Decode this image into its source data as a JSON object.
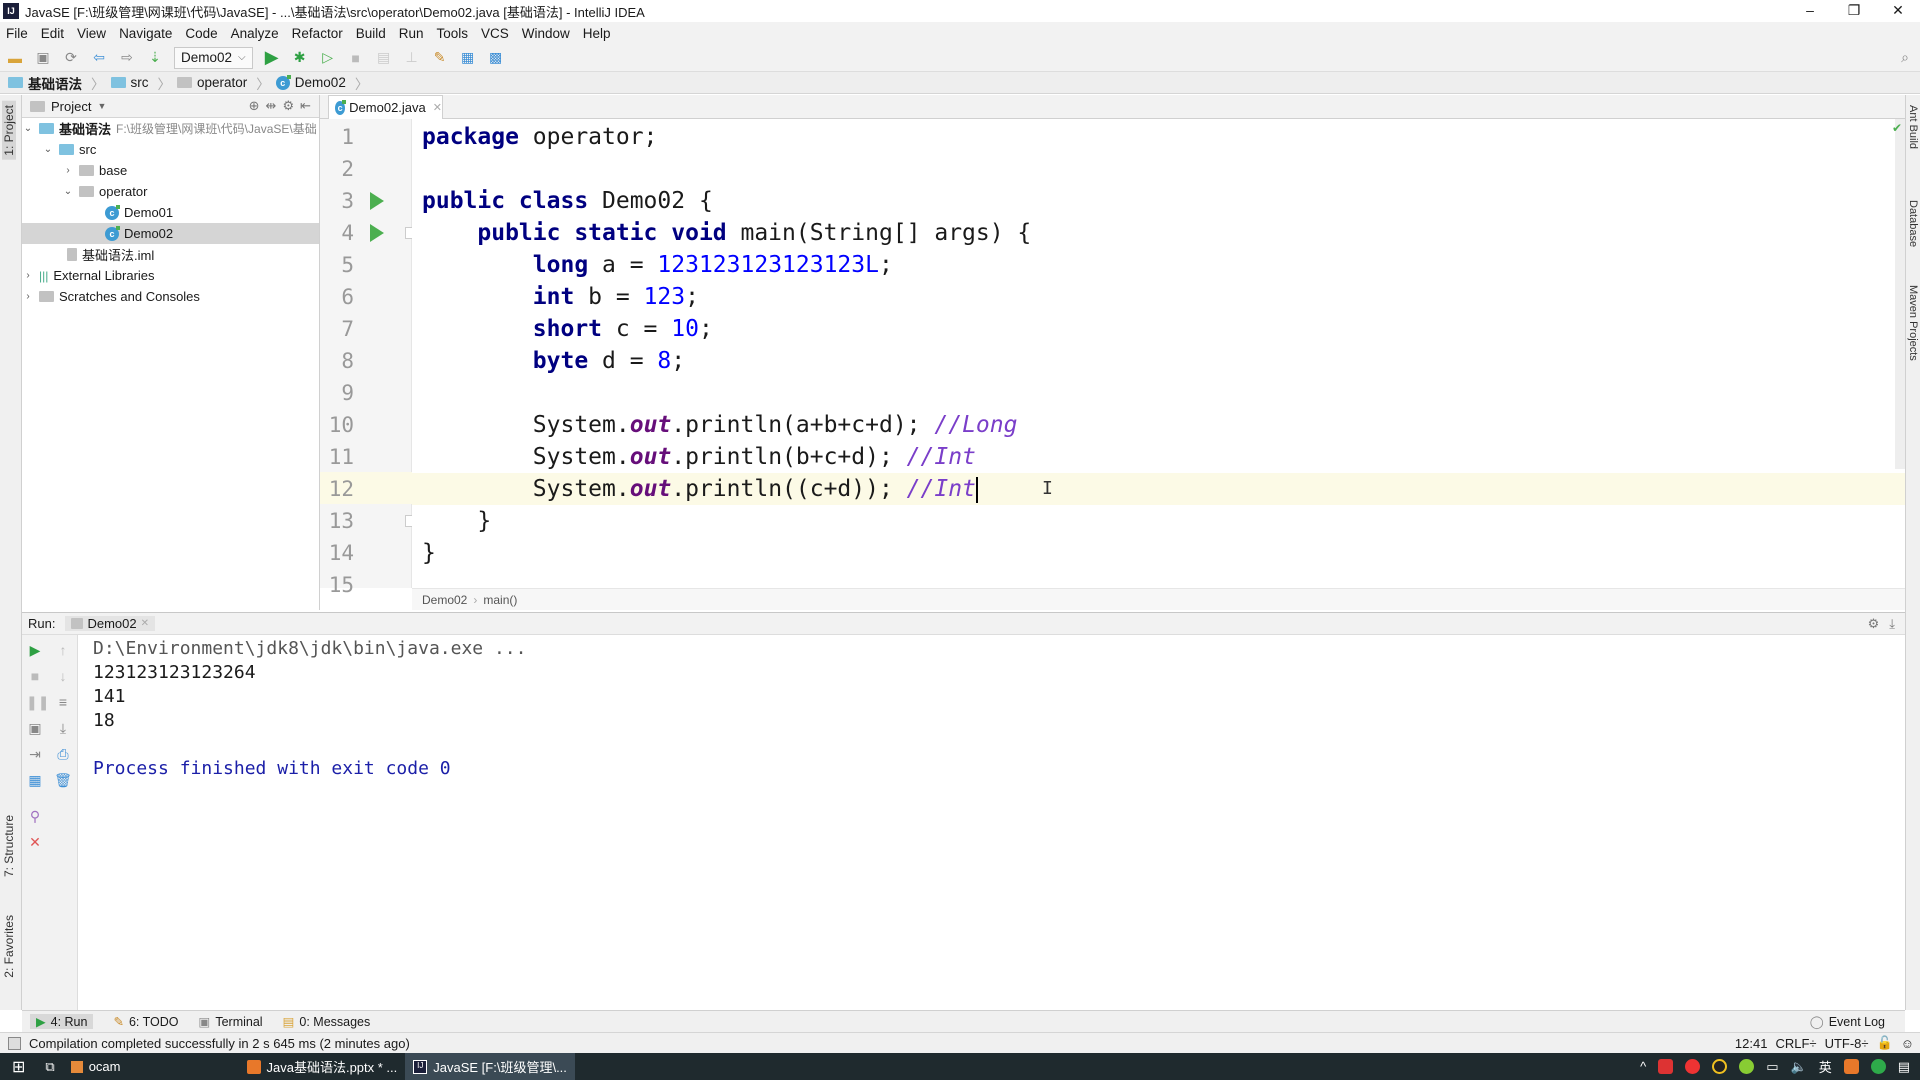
{
  "window": {
    "title": "JavaSE [F:\\班级管理\\网课班\\代码\\JavaSE] - ...\\基础语法\\src\\operator\\Demo02.java [基础语法] - IntelliJ IDEA"
  },
  "menu": [
    "File",
    "Edit",
    "View",
    "Navigate",
    "Code",
    "Analyze",
    "Refactor",
    "Build",
    "Run",
    "Tools",
    "VCS",
    "Window",
    "Help"
  ],
  "toolbar": {
    "run_config": "Demo02"
  },
  "navbar": {
    "crumbs": [
      "基础语法",
      "src",
      "operator",
      "Demo02"
    ]
  },
  "left_stripe": {
    "project": "1: Project",
    "structure": "7: Structure",
    "favorites": "2: Favorites"
  },
  "right_stripe": {
    "ant": "Ant Build",
    "database": "Database",
    "maven": "Maven Projects"
  },
  "project_panel": {
    "title": "Project",
    "root": {
      "name": "基础语法",
      "path": "F:\\班级管理\\网课班\\代码\\JavaSE\\基础"
    },
    "items": [
      "src",
      "base",
      "operator",
      "Demo01",
      "Demo02",
      "基础语法.iml",
      "External Libraries",
      "Scratches and Consoles"
    ],
    "selected": "Demo02"
  },
  "editor": {
    "tab": "Demo02.java",
    "line_numbers": [
      "1",
      "2",
      "3",
      "4",
      "5",
      "6",
      "7",
      "8",
      "9",
      "10",
      "11",
      "12",
      "13",
      "14",
      "15"
    ],
    "current_line": 12,
    "breadcrumb": [
      "Demo02",
      "main()"
    ],
    "code": {
      "l1": [
        "package",
        " operator;"
      ],
      "l3": [
        "public class",
        " Demo02 {"
      ],
      "l4": [
        "    public static void",
        " main(String[] args) {"
      ],
      "l5": [
        "        long",
        " a = ",
        "123123123123123L",
        ";"
      ],
      "l6": [
        "        int",
        " b = ",
        "123",
        ";"
      ],
      "l7": [
        "        short",
        " c = ",
        "10",
        ";"
      ],
      "l8": [
        "        byte",
        " d = ",
        "8",
        ";"
      ],
      "l10": [
        "        System.",
        "out",
        ".println(a+b+c+d); ",
        "//Long"
      ],
      "l11": [
        "        System.",
        "out",
        ".println(b+c+d); ",
        "//Int"
      ],
      "l12": [
        "        System.",
        "out",
        ".println((c+d)); ",
        "//Int"
      ],
      "l13": "    }",
      "l14": "}"
    }
  },
  "run_panel": {
    "label": "Run:",
    "tab": "Demo02",
    "output": [
      "D:\\Environment\\jdk8\\jdk\\bin\\java.exe ...",
      "123123123123264",
      "141",
      "18",
      "",
      "Process finished with exit code 0"
    ]
  },
  "tool_tabs": [
    "4: Run",
    "6: TODO",
    "Terminal",
    "0: Messages",
    "Event Log"
  ],
  "status": {
    "message": "Compilation completed successfully in 2 s 645 ms (2 minutes ago)",
    "position": "12:41",
    "line_sep": "CRLF÷",
    "encoding": "UTF-8÷"
  },
  "taskbar": {
    "items": [
      "ocam",
      "Java基础语法.pptx * ...",
      "JavaSE [F:\\班级管理\\..."
    ],
    "ime": "英"
  },
  "colors": {
    "keyword": "#000080",
    "number": "#0000ff",
    "comment": "#7a3ec9",
    "field": "#660e7a",
    "run_green": "#4caf50",
    "current_line": "#fcfae6"
  }
}
